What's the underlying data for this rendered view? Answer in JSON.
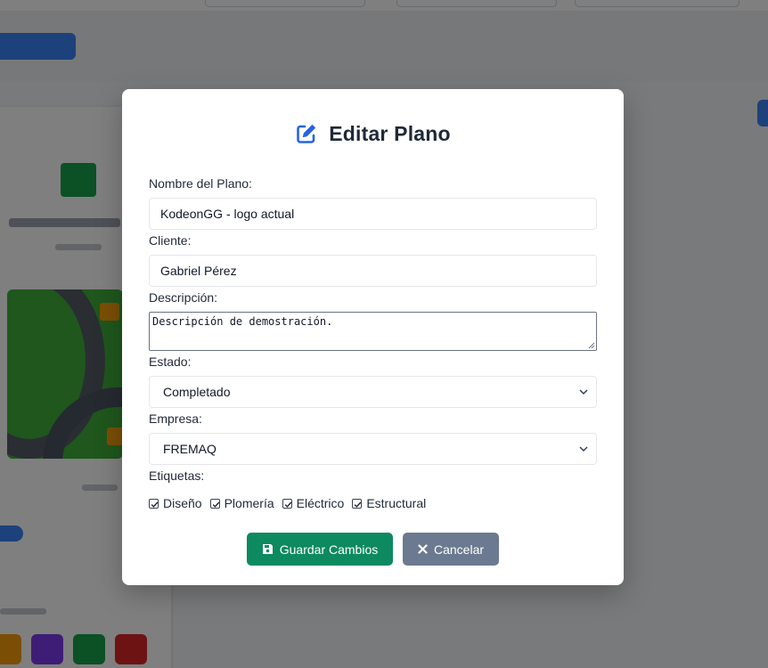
{
  "modal": {
    "title": "Editar Plano",
    "icon": "edit-icon",
    "fields": {
      "name": {
        "label": "Nombre del Plano:",
        "value": "KodeonGG - logo actual"
      },
      "client": {
        "label": "Cliente:",
        "value": "Gabriel Pérez"
      },
      "description": {
        "label": "Descripción:",
        "value": "Descripción de demostración."
      },
      "status": {
        "label": "Estado:",
        "value": "Completado"
      },
      "company": {
        "label": "Empresa:",
        "value": "FREMAQ"
      }
    },
    "tags": {
      "label": "Etiquetas:",
      "items": [
        {
          "label": "Diseño",
          "checked": true
        },
        {
          "label": "Plomería",
          "checked": true
        },
        {
          "label": "Eléctrico",
          "checked": true
        },
        {
          "label": "Estructural",
          "checked": true
        }
      ]
    },
    "buttons": {
      "save": {
        "label": "Guardar Cambios",
        "icon": "save-icon",
        "color": "#0d8a5f"
      },
      "cancel": {
        "label": "Cancelar",
        "icon": "close-icon",
        "color": "#6b7a90"
      }
    }
  },
  "colors": {
    "accent": "#2563eb",
    "overlay": "rgba(0,0,0,0.5)"
  }
}
